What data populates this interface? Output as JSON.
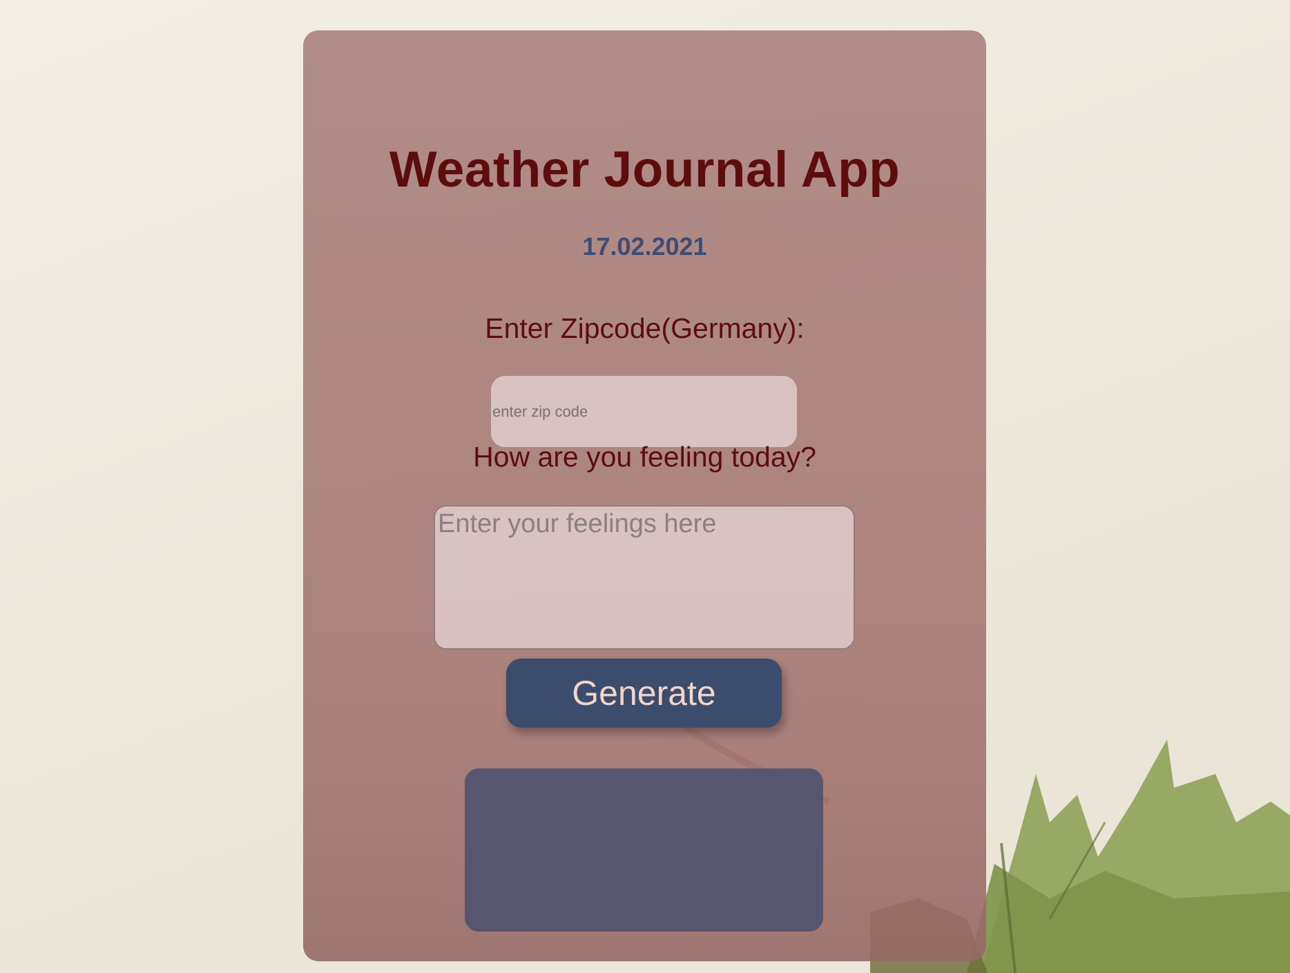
{
  "app": {
    "title": "Weather Journal App",
    "date": "17.02.2021"
  },
  "zip": {
    "label": "Enter Zipcode(Germany):",
    "placeholder": "enter zip code",
    "value": ""
  },
  "feelings": {
    "label": "How are you feeling today?",
    "placeholder": "Enter your feelings here",
    "value": ""
  },
  "actions": {
    "generate_label": "Generate"
  },
  "theme": {
    "title_color": "#5e0d0e",
    "date_color": "#3f4c74",
    "button_color": "#3c4c6d",
    "button_text_color": "#f3d5c8",
    "card_color": "#a87f7c",
    "entry_holder_color": "#484e6e"
  },
  "icons": {
    "background": "maple-leaf-icon"
  }
}
